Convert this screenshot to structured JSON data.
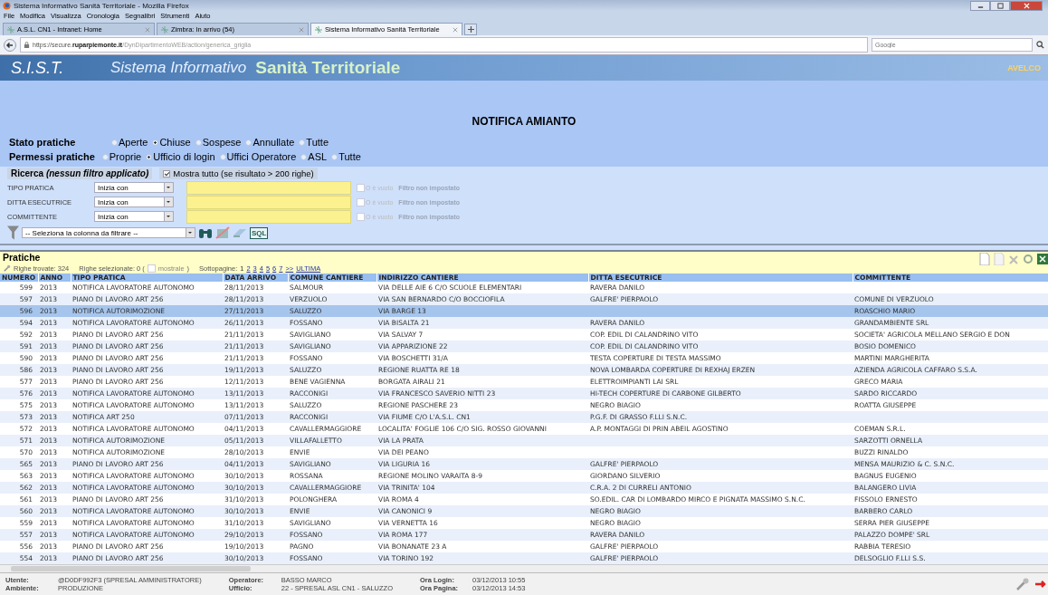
{
  "window": {
    "title": "Sistema Informativo Sanità Territoriale - Mozilla Firefox"
  },
  "menu": [
    "File",
    "Modifica",
    "Visualizza",
    "Cronologia",
    "Segnalibri",
    "Strumenti",
    "Aiuto"
  ],
  "tabs": [
    {
      "label": "A.S.L. CN1 - Intranet: Home",
      "selected": false
    },
    {
      "label": "Zimbra: In arrivo (54)",
      "selected": false
    },
    {
      "label": "Sistema Informativo Sanità Territoriale",
      "selected": true
    }
  ],
  "address": {
    "host": "https://secure.",
    "domain": "ruparpiemonte.it",
    "path": "/DynDipartimentoWEB/action/generica_griglia"
  },
  "search": {
    "placeholder": "Google"
  },
  "banner": {
    "logo": "S.I.S.T.",
    "title1": "Sistema Informativo",
    "title2": "Sanità Territoriale",
    "brand": "AVELCO"
  },
  "page_title": "NOTIFICA AMIANTO",
  "stato": {
    "label": "Stato pratiche",
    "options": [
      {
        "label": "Aperte",
        "selected": false
      },
      {
        "label": "Chiuse",
        "selected": true
      },
      {
        "label": "Sospese",
        "selected": false
      },
      {
        "label": "Annullate",
        "selected": false
      },
      {
        "label": "Tutte",
        "selected": false
      }
    ]
  },
  "permessi": {
    "label": "Permessi pratiche",
    "options": [
      {
        "label": "Proprie",
        "selected": false
      },
      {
        "label": "Ufficio di login",
        "selected": true
      },
      {
        "label": "Uffici Operatore",
        "selected": false
      },
      {
        "label": "ASL",
        "selected": false
      },
      {
        "label": "Tutte",
        "selected": false
      }
    ]
  },
  "ricerca": {
    "title": "Ricerca *(nessun filtro applicato)*",
    "show_all": {
      "label": "Mostra tutto (se risultato > 200 righe)",
      "checked": true
    },
    "filters": [
      {
        "label": "TIPO PRATICA",
        "operator": "Inizia con",
        "empty_label": "O è vuoto",
        "empty_checked": false,
        "status": "Filtro non impostato"
      },
      {
        "label": "DITTA ESECUTRICE",
        "operator": "Inizia con",
        "empty_label": "O è vuoto",
        "empty_checked": false,
        "status": "Filtro non impostato"
      },
      {
        "label": "COMMITTENTE",
        "operator": "Inizia con",
        "empty_label": "O è vuoto",
        "empty_checked": false,
        "status": "Filtro non impostato"
      }
    ],
    "column_select": "-- Seleziona la colonna da filtrare --",
    "sql": "SQL"
  },
  "pratiche": {
    "title": "Pratiche",
    "found": "Righe trovate: 324",
    "selected_text": "Righe selezionate: 0 (",
    "show_checked": false,
    "show_link": "mostrale",
    "close_paren": ")",
    "pages_label": "Sottopagine:",
    "pages": [
      "1",
      "2",
      "3",
      "4",
      "5",
      "6",
      "7",
      ">>",
      "ULTIMA"
    ]
  },
  "table": {
    "columns": [
      "NUMERO",
      "ANNO",
      "TIPO PRATICA",
      "DATA ARRIVO",
      "COMUNE CANTIERE",
      "INDIRIZZO CANTIERE",
      "DITTA ESECUTRICE",
      "COMMITTENTE"
    ],
    "rows": [
      {
        "cells": [
          "599",
          "2013",
          "NOTIFICA LAVORATORE AUTONOMO",
          "28/11/2013",
          "SALMOUR",
          "VIA DELLE AIE 6 C/O SCUOLE ELEMENTARI",
          "RAVERA DANILO",
          null
        ],
        "selected": false
      },
      {
        "cells": [
          "597",
          "2013",
          "PIANO DI LAVORO ART 256",
          "28/11/2013",
          "VERZUOLO",
          "VIA SAN BERNARDO C/O BOCCIOFILA",
          "GALFRE' PIERPAOLO",
          "COMUNE DI VERZUOLO"
        ],
        "selected": false
      },
      {
        "cells": [
          "596",
          "2013",
          "NOTIFICA AUTORIMOZIONE",
          "27/11/2013",
          "SALUZZO",
          "VIA BARGE 13",
          null,
          "ROASCHIO MARIO"
        ],
        "selected": true
      },
      {
        "cells": [
          "594",
          "2013",
          "NOTIFICA LAVORATORE AUTONOMO",
          "26/11/2013",
          "FOSSANO",
          "VIA BISALTA 21",
          "RAVERA DANILO",
          "GRANDAMBIENTE SRL"
        ],
        "selected": false
      },
      {
        "cells": [
          "592",
          "2013",
          "PIANO DI LAVORO ART 256",
          "21/11/2013",
          "SAVIGLIANO",
          "VIA SALVAY 7",
          "COP. EDIL DI CALANDRINO VITO",
          "SOCIETA' AGRICOLA MELLANO SERGIO E DON"
        ],
        "selected": false
      },
      {
        "cells": [
          "591",
          "2013",
          "PIANO DI LAVORO ART 256",
          "21/11/2013",
          "SAVIGLIANO",
          "VIA APPARIZIONE 22",
          "COP. EDIL DI CALANDRINO VITO",
          "BOSIO DOMENICO"
        ],
        "selected": false
      },
      {
        "cells": [
          "590",
          "2013",
          "PIANO DI LAVORO ART 256",
          "21/11/2013",
          "FOSSANO",
          "VIA BOSCHETTI 31/A",
          "TESTA COPERTURE DI TESTA MASSIMO",
          "MARTINI MARGHERITA"
        ],
        "selected": false
      },
      {
        "cells": [
          "586",
          "2013",
          "PIANO DI LAVORO ART 256",
          "19/11/2013",
          "SALUZZO",
          "REGIONE RUATTA RE 18",
          "NOVA LOMBARDA COPERTURE DI REXHAJ ERZEN",
          "AZIENDA AGRICOLA CAFFARO S.S.A."
        ],
        "selected": false
      },
      {
        "cells": [
          "577",
          "2013",
          "PIANO DI LAVORO ART 256",
          "12/11/2013",
          "BENE VAGIENNA",
          "BORGATA AIRALI 21",
          "ELETTROIMPIANTI LAI SRL",
          "GRECO MARIA"
        ],
        "selected": false
      },
      {
        "cells": [
          "576",
          "2013",
          "NOTIFICA LAVORATORE AUTONOMO",
          "13/11/2013",
          "RACCONIGI",
          "VIA FRANCESCO SAVERIO NITTI 23",
          "HI-TECH COPERTURE DI CARBONE GILBERTO",
          "SARDO RICCARDO"
        ],
        "selected": false
      },
      {
        "cells": [
          "575",
          "2013",
          "NOTIFICA LAVORATORE AUTONOMO",
          "13/11/2013",
          "SALUZZO",
          "REGIONE PASCHERE 23",
          "NEGRO BIAGIO",
          "ROATTA GIUSEPPE"
        ],
        "selected": false
      },
      {
        "cells": [
          "573",
          "2013",
          "NOTIFICA ART 250",
          "07/11/2013",
          "RACCONIGI",
          "VIA FIUME C/O L'A.S.L. CN1",
          "P.G.F. DI GRASSO F.LLI S.N.C.",
          null
        ],
        "selected": false
      },
      {
        "cells": [
          "572",
          "2013",
          "NOTIFICA LAVORATORE AUTONOMO",
          "04/11/2013",
          "CAVALLERMAGGIORE",
          "LOCALITA' FOGLIE 106 C/O SIG. ROSSO GIOVANNI",
          "A.P. MONTAGGI DI PRIN ABEIL AGOSTINO",
          "COEMAN S.R.L."
        ],
        "selected": false
      },
      {
        "cells": [
          "571",
          "2013",
          "NOTIFICA AUTORIMOZIONE",
          "05/11/2013",
          "VILLAFALLETTO",
          "VIA LA PRATA",
          null,
          "SARZOTTI ORNELLA"
        ],
        "selected": false
      },
      {
        "cells": [
          "570",
          "2013",
          "NOTIFICA AUTORIMOZIONE",
          "28/10/2013",
          "ENVIE",
          "VIA DEI PEANO",
          null,
          "BUZZI RINALDO"
        ],
        "selected": false
      },
      {
        "cells": [
          "565",
          "2013",
          "PIANO DI LAVORO ART 256",
          "04/11/2013",
          "SAVIGLIANO",
          "VIA LIGURIA 16",
          "GALFRE' PIERPAOLO",
          "MENSA MAURIZIO & C. S.N.C."
        ],
        "selected": false
      },
      {
        "cells": [
          "563",
          "2013",
          "NOTIFICA LAVORATORE AUTONOMO",
          "30/10/2013",
          "ROSSANA",
          "REGIONE MOLINO VARAITA 8-9",
          "GIORDANO SILVERIO",
          "BAGNUS EUGENIO"
        ],
        "selected": false
      },
      {
        "cells": [
          "562",
          "2013",
          "NOTIFICA LAVORATORE AUTONOMO",
          "30/10/2013",
          "CAVALLERMAGGIORE",
          "VIA TRINITA' 104",
          "C.R.A. 2 DI CURRELI ANTONIO",
          "BALANGERO LIVIA"
        ],
        "selected": false
      },
      {
        "cells": [
          "561",
          "2013",
          "PIANO DI LAVORO ART 256",
          "31/10/2013",
          "POLONGHERA",
          "VIA ROMA 4",
          "SO.EDIL. CAR DI LOMBARDO MIRCO E PIGNATA MASSIMO S.N.C.",
          "FISSOLO ERNESTO"
        ],
        "selected": false
      },
      {
        "cells": [
          "560",
          "2013",
          "NOTIFICA LAVORATORE AUTONOMO",
          "30/10/2013",
          "ENVIE",
          "VIA CANONICI 9",
          "NEGRO BIAGIO",
          "BARBERO CARLO"
        ],
        "selected": false
      },
      {
        "cells": [
          "559",
          "2013",
          "NOTIFICA LAVORATORE AUTONOMO",
          "31/10/2013",
          "SAVIGLIANO",
          "VIA VERNETTA 16",
          "NEGRO BIAGIO",
          "SERRA PIER GIUSEPPE"
        ],
        "selected": false
      },
      {
        "cells": [
          "557",
          "2013",
          "NOTIFICA LAVORATORE AUTONOMO",
          "29/10/2013",
          "FOSSANO",
          "VIA ROMA 177",
          "RAVERA DANILO",
          "PALAZZO DOMPE' SRL"
        ],
        "selected": false
      },
      {
        "cells": [
          "556",
          "2013",
          "PIANO DI LAVORO ART 256",
          "19/10/2013",
          "PAGNO",
          "VIA BONANATE 23 A",
          "GALFRE' PIERPAOLO",
          "RABBIA TERESIO"
        ],
        "selected": false
      },
      {
        "cells": [
          "554",
          "2013",
          "PIANO DI LAVORO ART 256",
          "30/10/2013",
          "FOSSANO",
          "VIA TORINO 192",
          "GALFRE' PIERPAOLO",
          "DELSOGLIO F.LLI S.S."
        ],
        "selected": false
      }
    ]
  },
  "status_bar": [
    {
      "label": "Utente:",
      "value": "@D0DF992F3 (SPRESAL AMMINISTRATORE)"
    },
    {
      "label": "Ambiente:",
      "value": "PRODUZIONE"
    },
    {
      "label": "Operatore:",
      "value": "BASSO MARCO"
    },
    {
      "label": "Ufficio:",
      "value": "22 - SPRESAL ASL CN1 - SALUZZO"
    },
    {
      "label": "Ora Login:",
      "value": "03/12/2013 10:55"
    },
    {
      "label": "Ora Pagina:",
      "value": "03/12/2013 14:53"
    }
  ]
}
